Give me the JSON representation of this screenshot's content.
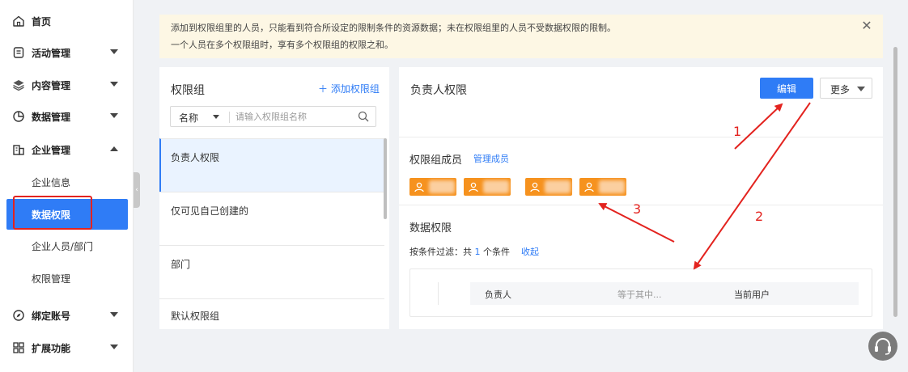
{
  "sidebar": {
    "items": [
      {
        "label": "首页",
        "icon": "home-icon"
      },
      {
        "label": "活动管理",
        "icon": "activity-icon"
      },
      {
        "label": "内容管理",
        "icon": "layers-icon"
      },
      {
        "label": "数据管理",
        "icon": "pie-chart-icon"
      },
      {
        "label": "企业管理",
        "icon": "building-icon"
      },
      {
        "label": "绑定账号",
        "icon": "compass-icon"
      },
      {
        "label": "扩展功能",
        "icon": "apps-icon"
      }
    ],
    "enterprise_sub": [
      {
        "label": "企业信息"
      },
      {
        "label": "数据权限",
        "active": true
      },
      {
        "label": "企业人员/部门"
      },
      {
        "label": "权限管理"
      }
    ]
  },
  "notice": {
    "line1": "添加到权限组里的人员，只能看到符合所设定的限制条件的资源数据；未在权限组里的人员不受数据权限的限制。",
    "line2": "一个人员在多个权限组时，享有多个权限组的权限之和。",
    "close": "✕"
  },
  "left_panel": {
    "title": "权限组",
    "add_label": "＋ 添加权限组",
    "search": {
      "select_value": "名称",
      "placeholder": "请输入权限组名称"
    },
    "groups": [
      {
        "label": "负责人权限",
        "active": true
      },
      {
        "label": "仅可见自己创建的"
      },
      {
        "label": "部门"
      },
      {
        "label": "默认权限组"
      }
    ]
  },
  "right_panel": {
    "title": "负责人权限",
    "edit_label": "编辑",
    "more_label": "更多",
    "members_title": "权限组成员",
    "manage_members": "管理成员",
    "data_title": "数据权限",
    "filter": {
      "prefix": "按条件过滤：共 ",
      "count": "1",
      "suffix": " 个条件",
      "collapse": "收起"
    },
    "condition": {
      "field": "负责人",
      "operator": "等于其中...",
      "value": "当前用户"
    }
  },
  "annotations": {
    "n1": "1",
    "n2": "2",
    "n3": "3"
  },
  "colors": {
    "primary": "#2f7cf6",
    "member_chip": "#f6921e",
    "highlight_red": "#e3231f",
    "notice_bg": "#fdf7e4"
  }
}
